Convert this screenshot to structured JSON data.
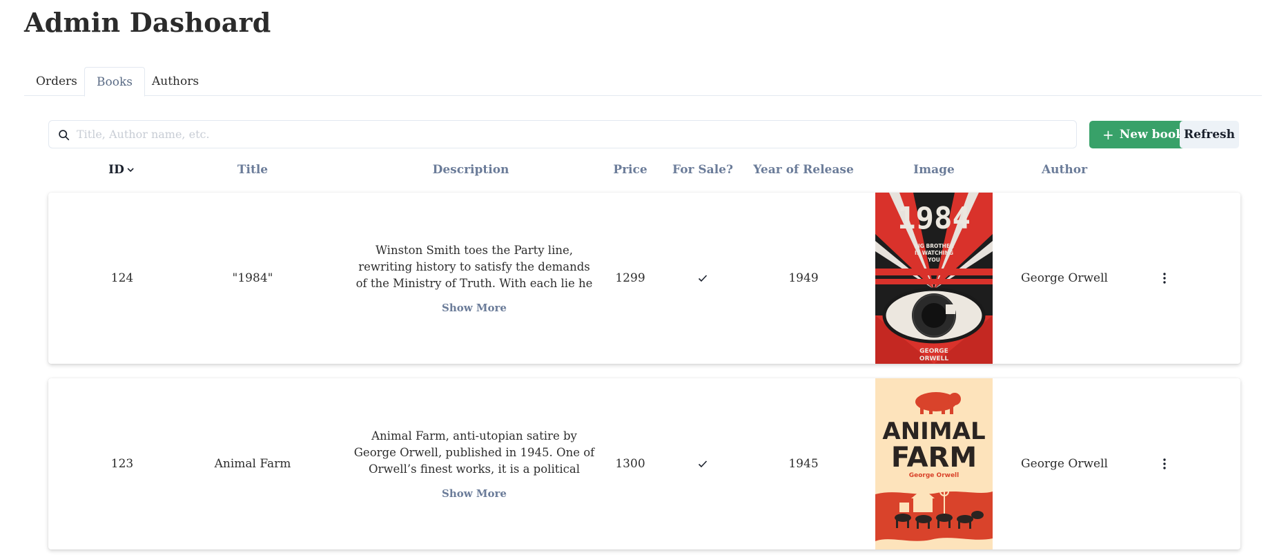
{
  "page": {
    "title": "Admin Dashoard"
  },
  "tabs": [
    {
      "label": "Orders",
      "active": false
    },
    {
      "label": "Books",
      "active": true
    },
    {
      "label": "Authors",
      "active": false
    }
  ],
  "search": {
    "placeholder": "Title, Author name, etc.",
    "value": ""
  },
  "toolbar": {
    "new_label": "New book",
    "new_icon": "plus-icon",
    "refresh_label": "Refresh"
  },
  "table": {
    "columns": [
      "ID",
      "Title",
      "Description",
      "Price",
      "For Sale?",
      "Year of Release",
      "Image",
      "Author"
    ],
    "sort_icon": "chevron-down-icon",
    "rows": [
      {
        "id": "124",
        "title": "\"1984\"",
        "description": "Winston Smith toes the Party line, rewriting history to satisfy the demands of the Ministry of Truth. With each lie he",
        "show_more": "Show More",
        "price": "1299",
        "for_sale": true,
        "year": "1949",
        "cover": {
          "title": "1984",
          "line1": "BIG BROTHER",
          "line2": "IS WATCHING",
          "line3": "YOU",
          "author1": "GEORGE",
          "author2": "ORWELL"
        },
        "author": "George Orwell"
      },
      {
        "id": "123",
        "title": "Animal Farm",
        "description": "Animal Farm, anti-utopian satire by George Orwell, published in 1945. One of Orwell’s finest works, it is a political fable based on",
        "show_more": "Show More",
        "price": "1300",
        "for_sale": true,
        "year": "1945",
        "cover": {
          "title1": "ANIMAL",
          "title2": "FARM",
          "author": "George Orwell"
        },
        "author": "George Orwell"
      }
    ]
  },
  "colors": {
    "primary": "#38a169",
    "muted": "#6b7c99",
    "border": "#e2e8f0",
    "cover_red": "#d9322b",
    "cover_cream": "#fde3bb"
  }
}
